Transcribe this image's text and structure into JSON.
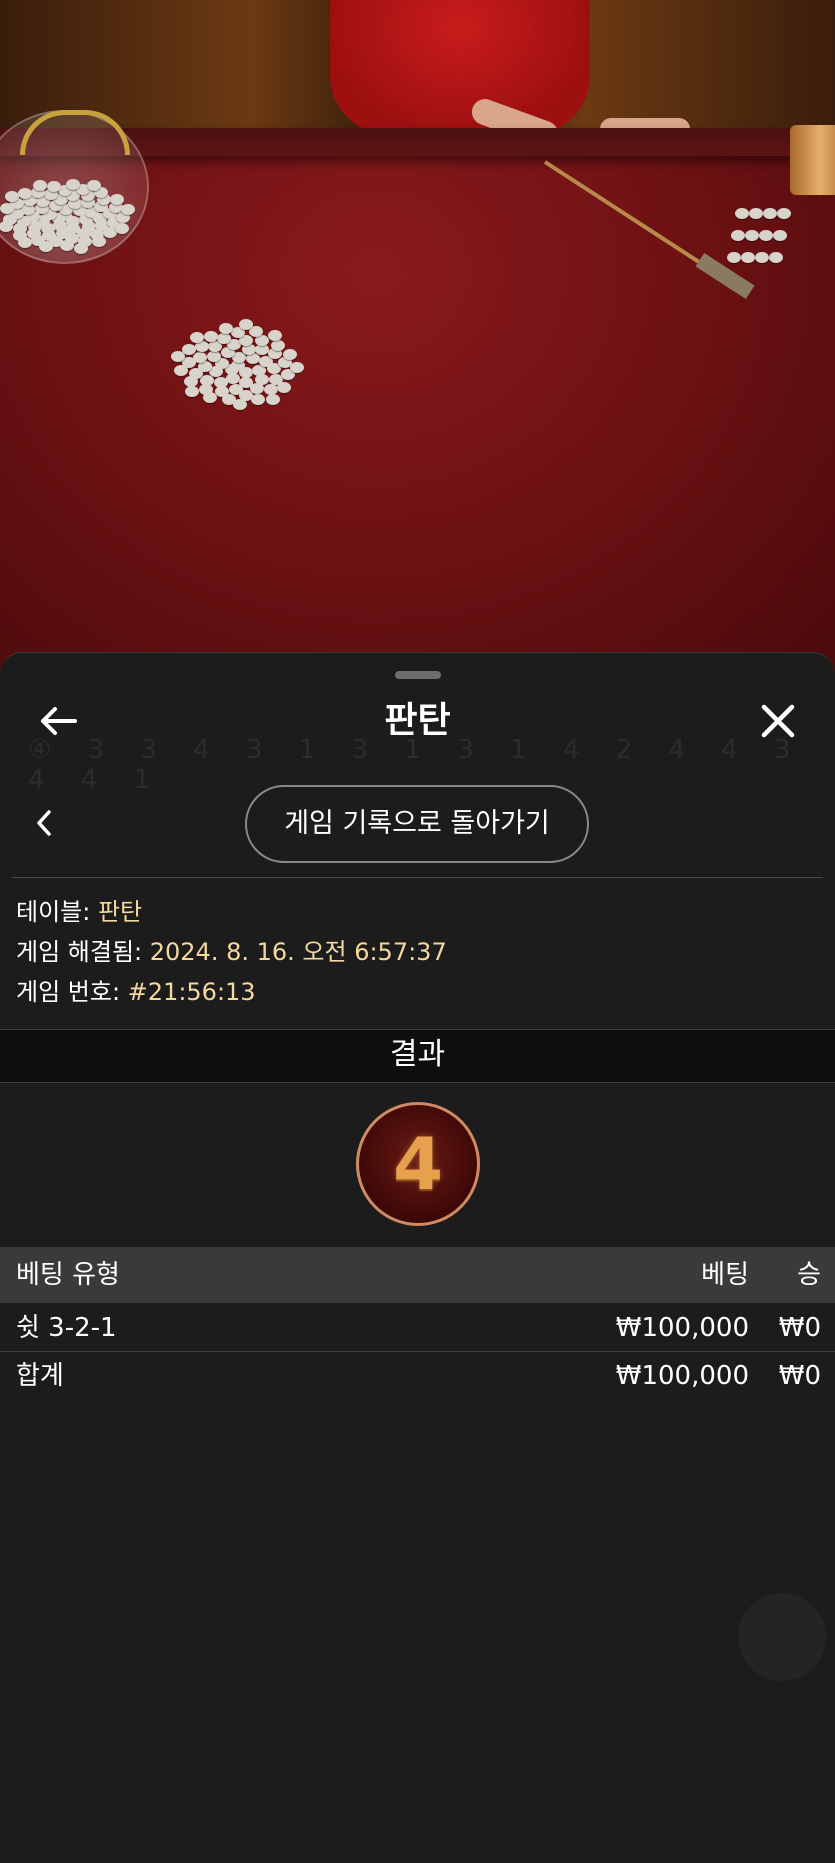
{
  "sheet": {
    "title": "판탄",
    "back_button": "게임 기록으로 돌아가기"
  },
  "details": {
    "table_label": "테이블: ",
    "table_value": "판탄",
    "resolved_label": "게임 해결됨: ",
    "resolved_value": "2024. 8. 16. 오전 6:57:37",
    "game_no_label": "게임 번호: ",
    "game_no_value": "#21:56:13"
  },
  "result": {
    "heading": "결과",
    "number": "4"
  },
  "bets_table": {
    "headers": {
      "type": "베팅 유형",
      "bet": "베팅",
      "win": "승"
    },
    "rows": [
      {
        "type": "쉿 3-2-1",
        "bet": "₩100,000",
        "win": "₩0"
      }
    ],
    "total": {
      "type": "합계",
      "bet": "₩100,000",
      "win": "₩0"
    }
  },
  "colors": {
    "sheet_bg": "#1c1c1c",
    "accent_value": "#f3d9a0",
    "table_felt": "#6f1214",
    "result_ball_border": "#d08a64"
  },
  "icons": {
    "back": "arrow-left-icon",
    "close": "close-icon",
    "prev": "chevron-left-icon"
  }
}
